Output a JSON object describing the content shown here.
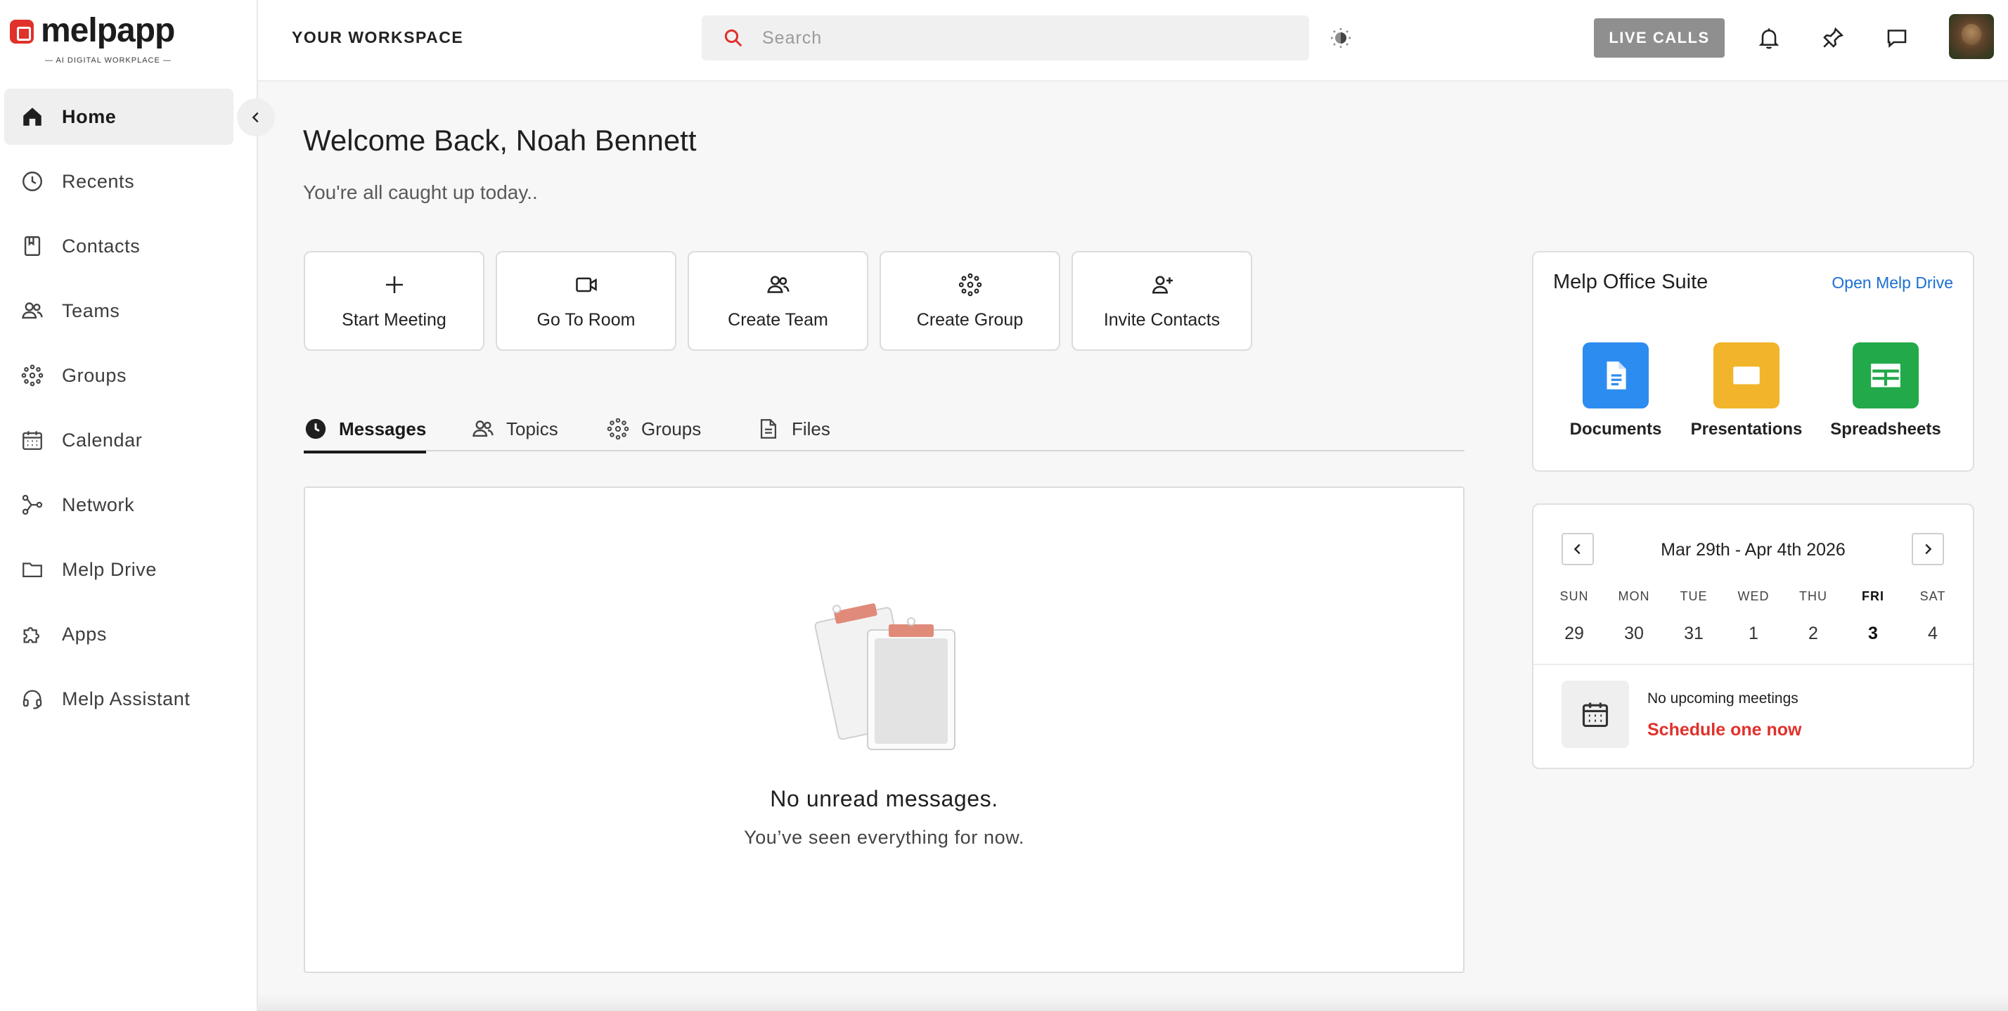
{
  "app": {
    "logo_text": "melpapp",
    "logo_tagline": "— AI DIGITAL WORKPLACE —"
  },
  "header": {
    "workspace_title": "YOUR WORKSPACE",
    "search_placeholder": "Search",
    "live_calls_label": "LIVE CALLS",
    "icons": [
      "theme-toggle-icon",
      "bell-icon",
      "pin-icon",
      "chat-icon"
    ]
  },
  "sidebar": {
    "items": [
      {
        "label": "Home",
        "icon": "home-icon",
        "active": true
      },
      {
        "label": "Recents",
        "icon": "clock-icon"
      },
      {
        "label": "Contacts",
        "icon": "bookmark-icon"
      },
      {
        "label": "Teams",
        "icon": "people-icon"
      },
      {
        "label": "Groups",
        "icon": "groups-icon"
      },
      {
        "label": "Calendar",
        "icon": "calendar-icon"
      },
      {
        "label": "Network",
        "icon": "network-icon"
      },
      {
        "label": "Melp Drive",
        "icon": "folder-icon"
      },
      {
        "label": "Apps",
        "icon": "puzzle-icon"
      },
      {
        "label": "Melp Assistant",
        "icon": "headset-icon"
      }
    ]
  },
  "main": {
    "welcome": "Welcome Back, Noah Bennett",
    "subtitle": "You're all caught up today..",
    "actions": [
      {
        "label": "Start Meeting",
        "icon": "plus-icon"
      },
      {
        "label": "Go To Room",
        "icon": "video-camera-icon"
      },
      {
        "label": "Create Team",
        "icon": "team-icon"
      },
      {
        "label": "Create Group",
        "icon": "group-dots-icon"
      },
      {
        "label": "Invite Contacts",
        "icon": "add-person-icon"
      }
    ],
    "tabs": [
      {
        "label": "Messages",
        "icon": "clock-filled-icon",
        "active": true
      },
      {
        "label": "Topics",
        "icon": "people-icon"
      },
      {
        "label": "Groups",
        "icon": "groups-icon"
      },
      {
        "label": "Files",
        "icon": "file-icon"
      }
    ],
    "empty_title": "No unread messages.",
    "empty_sub": "You’ve seen everything for now."
  },
  "office_suite": {
    "title": "Melp Office Suite",
    "open_link": "Open Melp Drive",
    "apps": [
      {
        "label": "Documents",
        "color": "#2d8cf0"
      },
      {
        "label": "Presentations",
        "color": "#f2b42b"
      },
      {
        "label": "Spreadsheets",
        "color": "#22a94a"
      }
    ]
  },
  "calendar": {
    "range": "Mar 29th - Apr 4th 2026",
    "days": [
      {
        "name": "SUN",
        "date": "29"
      },
      {
        "name": "MON",
        "date": "30"
      },
      {
        "name": "TUE",
        "date": "31"
      },
      {
        "name": "WED",
        "date": "1"
      },
      {
        "name": "THU",
        "date": "2"
      },
      {
        "name": "FRI",
        "date": "3",
        "today": true
      },
      {
        "name": "SAT",
        "date": "4"
      }
    ],
    "no_meetings": "No upcoming meetings",
    "schedule_link": "Schedule one now"
  },
  "colors": {
    "accent": "#e0312b",
    "link": "#1b6fd1"
  }
}
